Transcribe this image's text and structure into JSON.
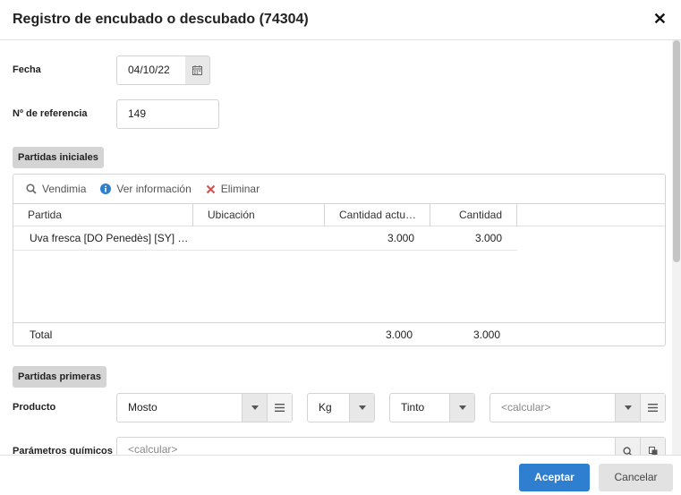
{
  "dialog": {
    "title": "Registro de encubado o descubado (74304)"
  },
  "fields": {
    "fecha_label": "Fecha",
    "fecha_value": "04/10/22",
    "ref_label": "Nº de referencia",
    "ref_value": "149"
  },
  "partidas_iniciales": {
    "section_label": "Partidas iniciales",
    "toolbar": {
      "vendimia": "Vendimia",
      "ver_info": "Ver información",
      "eliminar": "Eliminar"
    },
    "columns": [
      "Partida",
      "Ubicación",
      "Cantidad actu…",
      "Cantidad"
    ],
    "rows": [
      {
        "partida": "Uva fresca [DO Penedès] [SY] …",
        "ubicacion": "",
        "cantidad_actual": "3.000",
        "cantidad": "3.000"
      }
    ],
    "total": {
      "label": "Total",
      "cantidad_actual": "3.000",
      "cantidad": "3.000"
    }
  },
  "partidas_primeras": {
    "section_label": "Partidas primeras",
    "producto_label": "Producto",
    "producto_value": "Mosto",
    "unidad_value": "Kg",
    "tipo_value": "Tinto",
    "calcular_placeholder": "<calcular>",
    "parametros_label": "Parámetros químicos",
    "parametros_placeholder": "<calcular>"
  },
  "footer": {
    "accept": "Aceptar",
    "cancel": "Cancelar"
  },
  "colors": {
    "primary": "#2f7fd0",
    "delete": "#d9534f",
    "info": "#2f7fd0"
  },
  "icons": [
    "close-icon",
    "calendar-icon",
    "search-icon",
    "info-icon",
    "delete-icon",
    "chevron-down-icon",
    "menu-lines-icon",
    "copy-icon"
  ]
}
